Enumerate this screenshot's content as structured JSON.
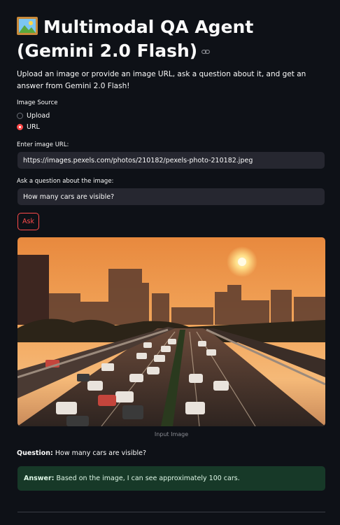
{
  "header": {
    "title": "Multimodal QA Agent (Gemini 2.0 Flash)",
    "emoji_icon": "framed-picture-icon",
    "anchor_icon": "link-icon"
  },
  "description": "Upload an image or provide an image URL, ask a question about it, and get an answer from Gemini 2.0 Flash!",
  "image_source": {
    "label": "Image Source",
    "options": [
      "Upload",
      "URL"
    ],
    "selected": "URL"
  },
  "url_input": {
    "label": "Enter image URL:",
    "value": "https://images.pexels.com/photos/210182/pexels-photo-210182.jpeg"
  },
  "question_input": {
    "label": "Ask a question about the image:",
    "value": "How many cars are visible?"
  },
  "ask_button": "Ask",
  "image_caption": "Input Image",
  "result": {
    "question_label": "Question:",
    "question_text": "How many cars are visible?",
    "answer_label": "Answer:",
    "answer_text": "Based on the image, I can see approximately 100 cars."
  },
  "colors": {
    "background": "#0e1117",
    "accent": "#ff4b4b",
    "input_bg": "#262730",
    "success_bg": "#173928"
  }
}
